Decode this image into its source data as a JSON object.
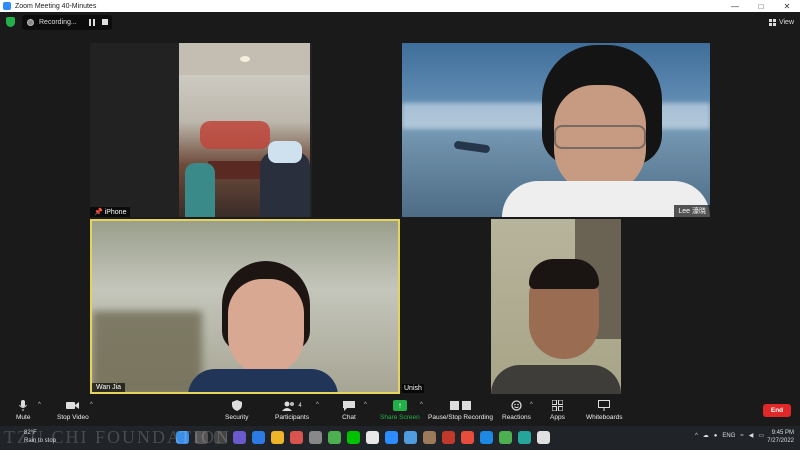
{
  "window": {
    "title": "Zoom Meeting 40-Minutes",
    "controls": [
      "—",
      "□",
      "✕"
    ]
  },
  "top": {
    "recording_label": "Recording...",
    "view_label": "View"
  },
  "tiles": [
    {
      "name": "iPhone"
    },
    {
      "name": "Lee 濠晓"
    },
    {
      "name": "Wan Jia"
    },
    {
      "name": "Unish"
    }
  ],
  "toolbar": {
    "mute": "Mute",
    "stop_video": "Stop Video",
    "security": "Security",
    "participants": "Participants",
    "participants_count": "4",
    "chat": "Chat",
    "share_screen": "Share Screen",
    "pause_stop_recording": "Pause/Stop Recording",
    "reactions": "Reactions",
    "apps": "Apps",
    "whiteboards": "Whiteboards",
    "end": "End"
  },
  "taskbar": {
    "weather_temp": "82°F",
    "weather_desc": "Rain to stop",
    "lang": "ENG",
    "time": "9:45 PM",
    "date": "7/27/2022",
    "watermark": "TZU CHI FOUNDATION"
  },
  "colors": {
    "share_green": "#23b04a",
    "end_red": "#e02828",
    "active_speaker": "#e5d45b",
    "zoom_blue": "#2d8cff"
  }
}
